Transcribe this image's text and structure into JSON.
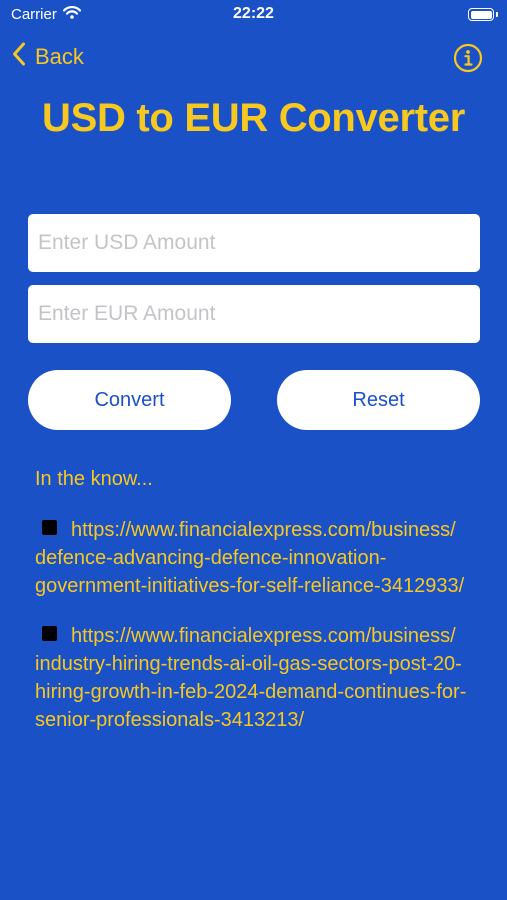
{
  "status_bar": {
    "carrier": "Carrier",
    "time": "22:22"
  },
  "nav": {
    "back_label": "Back",
    "back_icon": "chevron-left-icon",
    "info_icon": "info-circle-icon"
  },
  "title": "USD to EUR Converter",
  "inputs": {
    "usd": {
      "value": "",
      "placeholder": "Enter USD Amount"
    },
    "eur": {
      "value": "",
      "placeholder": "Enter EUR Amount"
    }
  },
  "buttons": {
    "convert": "Convert",
    "reset": "Reset"
  },
  "news": {
    "heading": "In the know...",
    "links": [
      "https://www.financialexpress.com/business/defence-advancing-defence-innovation-government-initiatives-for-self-reliance-3412933/",
      "https://www.financialexpress.com/business/industry-hiring-trends-ai-oil-gas-sectors-post-20-hiring-growth-in-feb-2024-demand-continues-for-senior-professionals-3413213/"
    ]
  },
  "colors": {
    "background": "#1a51c7",
    "accent": "#f7c820",
    "button_bg": "#ffffff",
    "button_text": "#1a51c7",
    "bullet": "#000000"
  }
}
